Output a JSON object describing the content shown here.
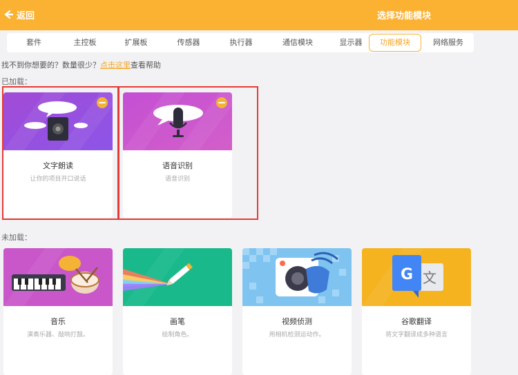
{
  "header": {
    "back_label": "返回",
    "title": "选择功能模块",
    "accent": "#fbb132"
  },
  "tabs": [
    {
      "label": "套件"
    },
    {
      "label": "主控板"
    },
    {
      "label": "扩展板"
    },
    {
      "label": "传感器"
    },
    {
      "label": "执行器"
    },
    {
      "label": "通信模块"
    },
    {
      "label": "显示器"
    },
    {
      "label": "功能模块",
      "active": true
    },
    {
      "label": "网络服务"
    }
  ],
  "hint": {
    "text_before": "找不到你想要的？数量很少？",
    "link": "点击这里",
    "text_after": "查看帮助"
  },
  "loaded": {
    "label": "已加载：",
    "cards": [
      {
        "name": "文字朗读",
        "desc": "让你的项目开口说话",
        "icon": "speaker-icon"
      },
      {
        "name": "语音识别",
        "desc": "语音识别",
        "icon": "microphone-icon"
      }
    ]
  },
  "unloaded": {
    "label": "未加载：",
    "cards": [
      {
        "name": "音乐",
        "desc": "演奏乐器、敲响打鼓。",
        "icon": "piano-drum-icon"
      },
      {
        "name": "画笔",
        "desc": "绘制角色。",
        "icon": "pen-icon"
      },
      {
        "name": "视频侦测",
        "desc": "用相机检测运动作。",
        "icon": "camera-hand-icon"
      },
      {
        "name": "谷歌翻译",
        "desc": "将文字翻译成多种语言",
        "icon": "translate-icon"
      }
    ]
  }
}
